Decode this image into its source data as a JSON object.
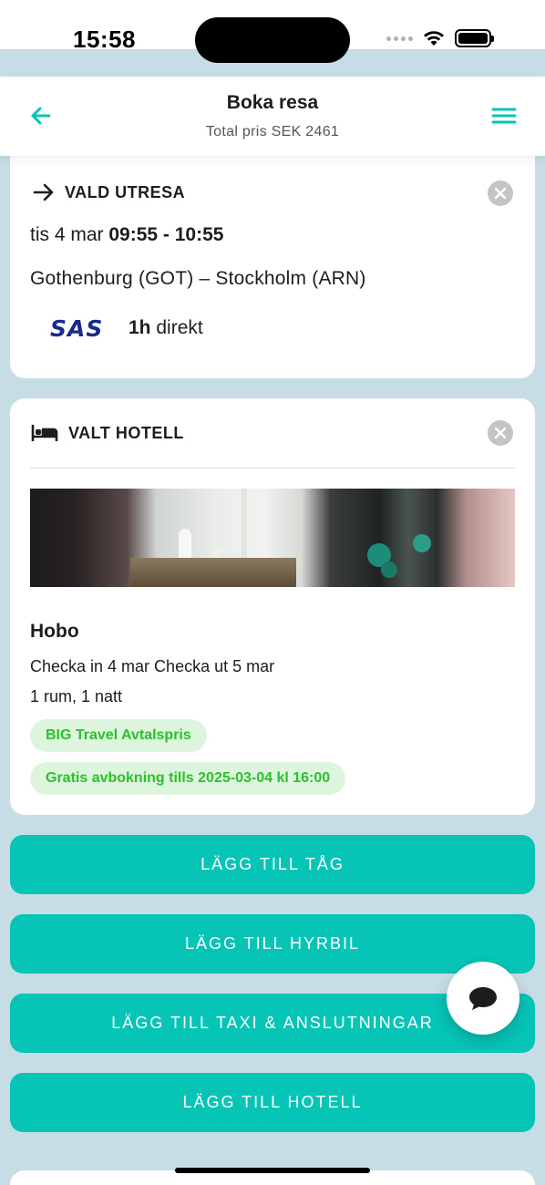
{
  "status_bar": {
    "time": "15:58",
    "icons": [
      "signal-icon",
      "wifi-icon",
      "battery-icon"
    ]
  },
  "header": {
    "title": "Boka resa",
    "subtitle": "Total pris SEK 2461",
    "back_icon": "arrow-left-icon",
    "menu_icon": "hamburger-menu-icon",
    "accent_color": "#06c4b6"
  },
  "flight_card": {
    "heading": "VALD UTRESA",
    "heading_icon": "arrow-right-icon",
    "date_prefix": "tis 4 mar",
    "time_range": "09:55 - 10:55",
    "route": "Gothenburg (GOT) – Stockholm (ARN)",
    "airline_logo": "SAS",
    "duration": "1h",
    "duration_suffix": "direkt"
  },
  "hotel_card": {
    "heading": "VALT HOTELL",
    "heading_icon": "bed-icon",
    "name": "Hobo",
    "dates": "Checka in 4 mar  Checka ut 5 mar",
    "rooms": "1 rum, 1 natt",
    "badges": [
      "BIG Travel Avtalspris",
      "Gratis avbokning tills 2025-03-04 kl 16:00"
    ],
    "badge_color": "#2cc02c"
  },
  "actions": [
    "LÄGG TILL TÅG",
    "LÄGG TILL HYRBIL",
    "LÄGG TILL TAXI & ANSLUTNINGAR",
    "LÄGG TILL HOTELL"
  ],
  "chat_icon": "chat-bubble-icon",
  "background_color": "#c6dde5"
}
